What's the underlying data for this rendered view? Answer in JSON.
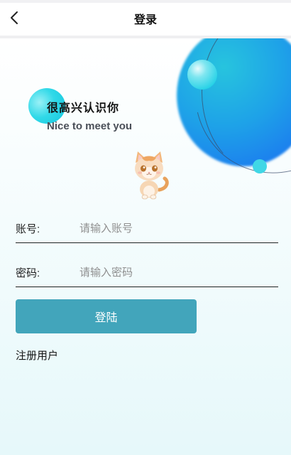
{
  "header": {
    "title": "登录",
    "back_icon": "chevron-left-icon"
  },
  "welcome": {
    "title": "很高兴认识你",
    "subtitle": "Nice to meet you"
  },
  "avatar": {
    "icon": "kitten-avatar"
  },
  "form": {
    "account": {
      "label": "账号:",
      "placeholder": "请输入账号",
      "value": ""
    },
    "password": {
      "label": "密码:",
      "placeholder": "请输入密码",
      "value": ""
    },
    "login_label": "登陆",
    "register_label": "注册用户"
  },
  "colors": {
    "accent": "#42a5bb",
    "bubble": "#1ea2e8",
    "dot": "#40d7e6"
  }
}
